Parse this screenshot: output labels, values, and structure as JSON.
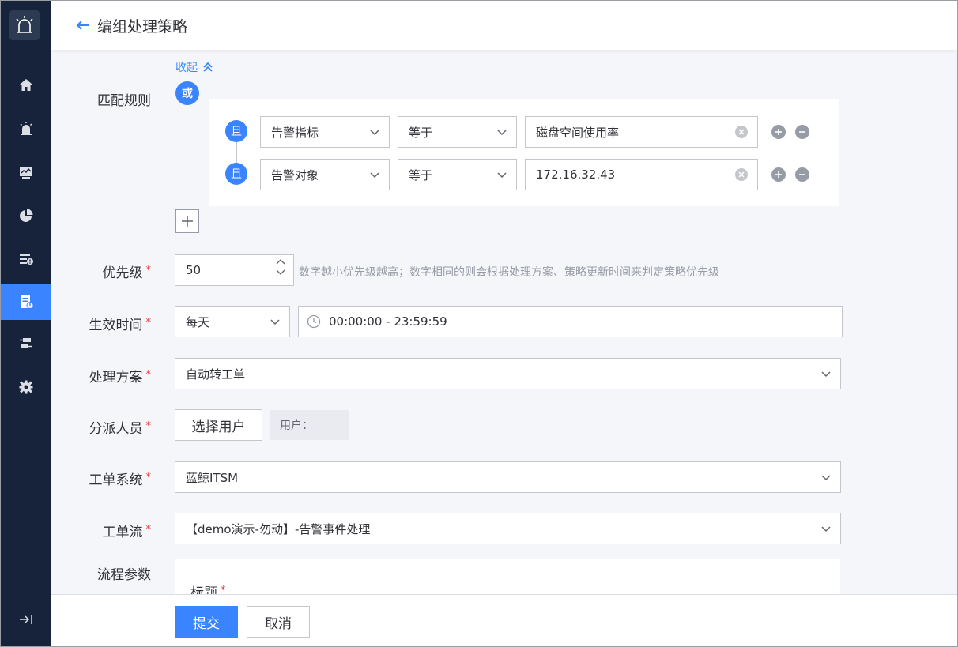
{
  "header": {
    "title": "编组处理策略"
  },
  "sidebar": {
    "items": [
      {
        "icon": "home-icon"
      },
      {
        "icon": "alarm-icon"
      },
      {
        "icon": "monitor-chart-icon"
      },
      {
        "icon": "pie-chart-icon"
      },
      {
        "icon": "event-list-icon"
      },
      {
        "icon": "strategy-doc-icon",
        "active": true
      },
      {
        "icon": "workflow-icon"
      },
      {
        "icon": "gear-icon"
      }
    ],
    "collapse_icon": "collapse-sidebar-icon"
  },
  "match_rules": {
    "label": "匹配规则",
    "collapse_label": "收起",
    "or_label": "或",
    "and_label": "且",
    "conditions": [
      {
        "field": "告警指标",
        "operator": "等于",
        "value": "磁盘空间使用率"
      },
      {
        "field": "告警对象",
        "operator": "等于",
        "value": "172.16.32.43"
      }
    ]
  },
  "priority": {
    "label": "优先级",
    "value": "50",
    "hint": "数字越小优先级越高；数字相同的则会根据处理方案、策略更新时间来判定策略优先级"
  },
  "effective_time": {
    "label": "生效时间",
    "period": "每天",
    "range": "00:00:00 - 23:59:59"
  },
  "handling_plan": {
    "label": "处理方案",
    "value": "自动转工单"
  },
  "assignee": {
    "label": "分派人员",
    "button_label": "选择用户",
    "users_prefix": "用户："
  },
  "ticket_system": {
    "label": "工单系统",
    "value": "蓝鲸ITSM"
  },
  "ticket_flow": {
    "label": "工单流",
    "value": "【demo演示-勿动】-告警事件处理"
  },
  "flow_params": {
    "label": "流程参数",
    "title_label": "标题"
  },
  "footer": {
    "submit_label": "提交",
    "cancel_label": "取消"
  },
  "colors": {
    "primary": "#3a84ff",
    "sidebar_bg": "#17233b",
    "required": "#ea3636"
  }
}
